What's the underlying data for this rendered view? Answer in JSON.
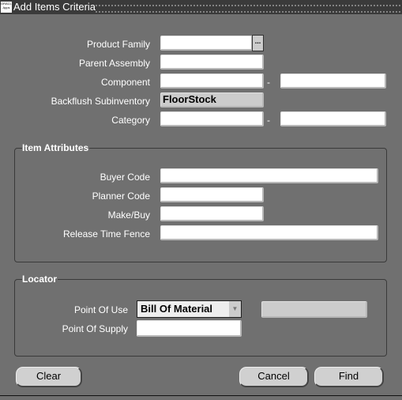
{
  "window": {
    "title": "Add Items Criteria",
    "app_icon": "oracle-icon"
  },
  "form": {
    "product_family": {
      "label": "Product Family",
      "value": ""
    },
    "parent_assembly": {
      "label": "Parent Assembly",
      "value": ""
    },
    "component": {
      "label": "Component",
      "from": "",
      "to": "",
      "separator": "-"
    },
    "backflush_subinventory": {
      "label": "Backflush Subinventory",
      "value": "FloorStock"
    },
    "category": {
      "label": "Category",
      "from": "",
      "to": "",
      "separator": "-"
    },
    "lov_button": "..."
  },
  "item_attributes": {
    "title": "Item Attributes",
    "buyer_code": {
      "label": "Buyer Code",
      "value": ""
    },
    "planner_code": {
      "label": "Planner Code",
      "value": ""
    },
    "make_buy": {
      "label": "Make/Buy",
      "value": ""
    },
    "release_time_fence": {
      "label": "Release Time Fence",
      "value": ""
    }
  },
  "locator": {
    "title": "Locator",
    "point_of_use": {
      "label": "Point Of Use",
      "selected": "Bill Of Material",
      "extra_value": ""
    },
    "point_of_supply": {
      "label": "Point Of Supply",
      "value": ""
    }
  },
  "buttons": {
    "clear": "Clear",
    "cancel": "Cancel",
    "find": "Find"
  }
}
